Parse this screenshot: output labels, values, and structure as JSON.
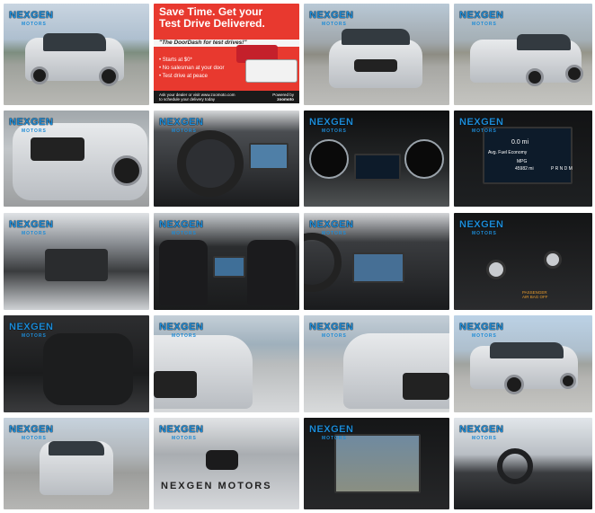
{
  "gallery": {
    "dealer_logo_main": "NEXGEN",
    "dealer_logo_sub": "MOTORS",
    "tiles": [
      {
        "id": "exterior-front-left-3q",
        "label": "Exterior front left three-quarter"
      },
      {
        "id": "promo-doordash",
        "label": "DoorDash test drive promo"
      },
      {
        "id": "exterior-front",
        "label": "Exterior front"
      },
      {
        "id": "exterior-front-right-3q",
        "label": "Exterior front right three-quarter"
      }
    ]
  },
  "promo": {
    "headline_line1": "Save Time. Get your",
    "headline_line2": "Test Drive Delivered.",
    "tagline": "\"The DoorDash for test drives!\"",
    "bullet1": "• Starts at $0*",
    "bullet2": "• No salesman at your door",
    "bullet3": "• Test drive at peace",
    "footer_line1": "Ask your dealer or visit www.zoomoto.com",
    "footer_line2": "to schedule your delivery today",
    "powered_by": "Powered by",
    "brand": "zoomoto",
    "accent_color": "#e8392f"
  },
  "cluster": {
    "odometer_label": "Avg. Fuel Economy",
    "value": "0.0 mi",
    "mpg_label": "MPG",
    "odometer": "45982 mi",
    "gear": "P R N D M"
  },
  "climate_panel": {
    "warning_text": "PASSENGER AIR BAG OFF"
  },
  "dealer_watermark": "NEXGEN MOTORS"
}
